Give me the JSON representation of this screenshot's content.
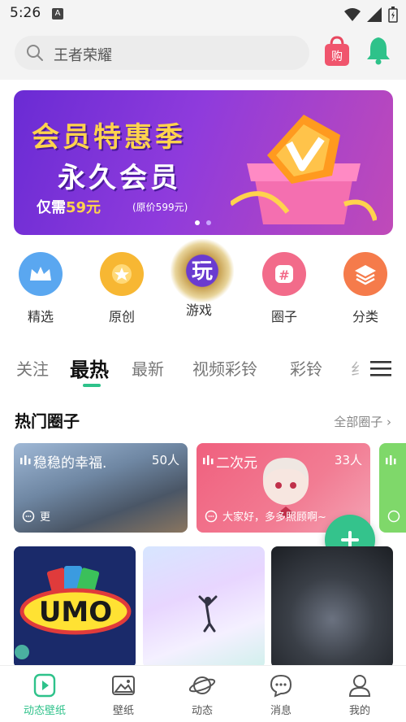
{
  "status_bar": {
    "time": "5:26"
  },
  "search": {
    "placeholder": "王者荣耀"
  },
  "shop": {
    "label": "购"
  },
  "banner": {
    "line1": "会员特惠季",
    "line2": "永久会员",
    "price_prefix": "仅需",
    "price": "59元",
    "original": "(原价599元)"
  },
  "categories": [
    {
      "label": "精选",
      "icon": "crown-icon",
      "color": "#5aa7f0"
    },
    {
      "label": "原创",
      "icon": "star-badge-icon",
      "color": "#f7b733"
    },
    {
      "label": "游戏",
      "icon": "game-emblem-icon",
      "color": "#c7a050",
      "emblem_text": "玩"
    },
    {
      "label": "圈子",
      "icon": "hashtag-icon",
      "color": "#f26b8a"
    },
    {
      "label": "分类",
      "icon": "layers-icon",
      "color": "#f57b4b"
    }
  ],
  "tabs": [
    {
      "label": "关注"
    },
    {
      "label": "最热"
    },
    {
      "label": "最新"
    },
    {
      "label": "视频彩铃"
    },
    {
      "label": "彩铃"
    },
    {
      "label": "纟"
    }
  ],
  "hot_circles": {
    "title": "热门圈子",
    "more": "全部圈子 ",
    "items": [
      {
        "name": "稳稳的幸福.",
        "count": "50人",
        "preview": "更"
      },
      {
        "name": "二次元",
        "count": "33人",
        "preview": "大家好，多多照顾啊~"
      }
    ]
  },
  "wallpapers": [
    {
      "text": "UMO"
    }
  ],
  "bottom_nav": [
    {
      "label": "动态壁纸",
      "icon": "play-video-icon",
      "active": true
    },
    {
      "label": "壁纸",
      "icon": "image-icon",
      "active": false
    },
    {
      "label": "动态",
      "icon": "planet-icon",
      "active": false
    },
    {
      "label": "消息",
      "icon": "chat-bubble-icon",
      "active": false
    },
    {
      "label": "我的",
      "icon": "user-icon",
      "active": false
    }
  ],
  "colors": {
    "accent": "#2ec28a",
    "banner": "#7a33d8"
  }
}
